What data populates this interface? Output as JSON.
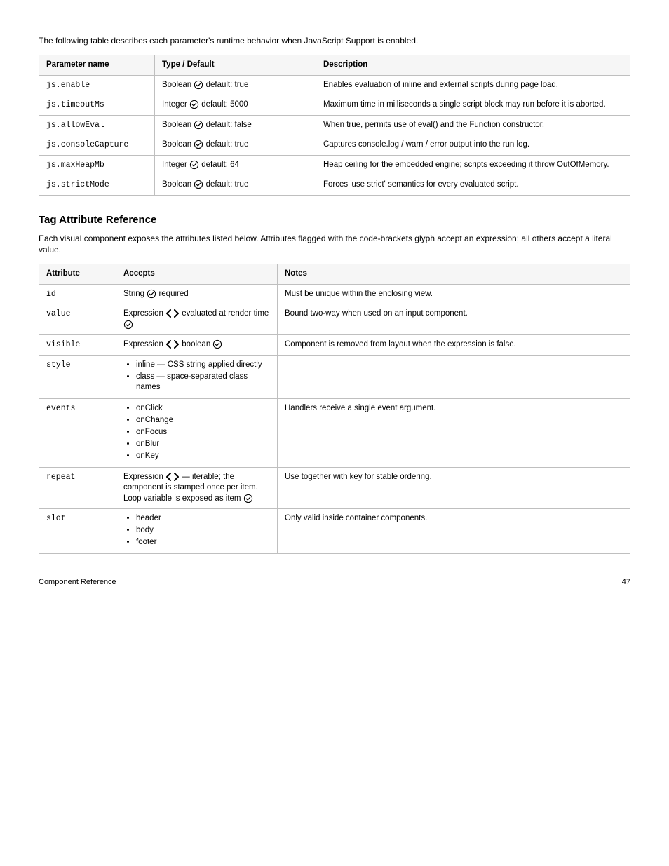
{
  "top_intro": "The following table describes each parameter's runtime behavior when JavaScript Support is enabled.",
  "table1": {
    "headers": [
      "Parameter name",
      "Type / Default",
      "Description"
    ],
    "rows": [
      {
        "name": "js.enable",
        "type_prefix": "Boolean ",
        "type_suffix": " default: true",
        "desc": "Enables evaluation of inline and external scripts during page load."
      },
      {
        "name": "js.timeoutMs",
        "type_prefix": "Integer ",
        "type_suffix": " default: 5000",
        "desc": "Maximum time in milliseconds a single script block may run before it is aborted."
      },
      {
        "name": "js.allowEval",
        "type_prefix": "Boolean ",
        "type_suffix": " default: false",
        "desc": "When true, permits use of eval() and the Function constructor."
      },
      {
        "name": "js.consoleCapture",
        "type_prefix": "Boolean ",
        "type_suffix": " default: true",
        "desc": "Captures console.log / warn / error output into the run log."
      },
      {
        "name": "js.maxHeapMb",
        "type_prefix": "Integer ",
        "type_suffix": " default: 64",
        "desc": "Heap ceiling for the embedded engine; scripts exceeding it throw OutOfMemory."
      },
      {
        "name": "js.strictMode",
        "type_prefix": "Boolean ",
        "type_suffix": " default: true",
        "desc": "Forces 'use strict' semantics for every evaluated script."
      }
    ]
  },
  "section2": {
    "title": "Tag Attribute Reference",
    "para": "Each visual component exposes the attributes listed below. Attributes flagged with the code-brackets glyph accept an expression; all others accept a literal value."
  },
  "table2": {
    "headers": [
      "Attribute",
      "Accepts",
      "Notes"
    ],
    "rows": [
      {
        "name": "id",
        "cell2_html": "String <CHECK> required",
        "cell3": "Must be unique within the enclosing view."
      },
      {
        "name": "value",
        "cell2_html": "Expression <CODE> evaluated at render time <CHECK>",
        "cell3": "Bound two-way when used on an input component."
      },
      {
        "name": "visible",
        "cell2_html": "Expression <CODE> boolean <CHECK>",
        "cell3": "Component is removed from layout when the expression is false."
      },
      {
        "name": "style",
        "list": [
          "inline — CSS string applied directly",
          "class — space-separated class names"
        ],
        "cell3": ""
      },
      {
        "name": "events",
        "list": [
          "onClick",
          "onChange",
          "onFocus",
          "onBlur",
          "onKey"
        ],
        "cell3": "Handlers receive a single event argument."
      },
      {
        "name": "repeat",
        "cell2_html": "Expression <CODE> — iterable; the component is stamped once per item. Loop variable is exposed as item <CHECK>",
        "cell3": "Use together with key for stable ordering."
      },
      {
        "name": "slot",
        "list": [
          "header",
          "body",
          "footer"
        ],
        "cell3": "Only valid inside container components."
      }
    ]
  },
  "footer": {
    "left": "Component Reference",
    "right": "47"
  },
  "aria": {
    "check": "supported",
    "code": "expression"
  }
}
